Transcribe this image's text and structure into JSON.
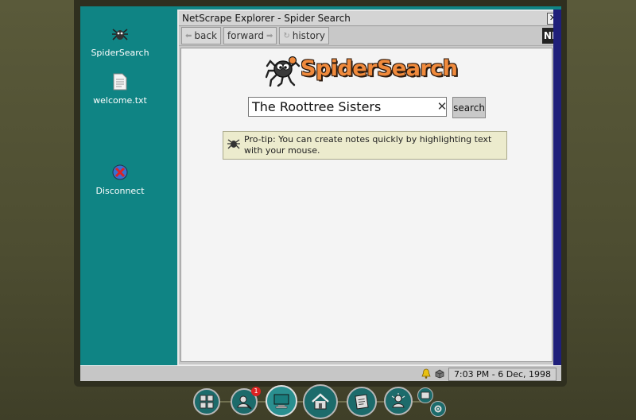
{
  "desktop": {
    "icons": [
      {
        "label": "SpiderSearch",
        "icon": "spider-icon"
      },
      {
        "label": "welcome.txt",
        "icon": "text-file-icon"
      },
      {
        "label": "Disconnect",
        "icon": "disconnect-icon"
      }
    ]
  },
  "window": {
    "title": "NetScrape Explorer - Spider Search",
    "close_label": "✕",
    "toolbar": {
      "back_label": "back",
      "forward_label": "forward",
      "history_label": "history",
      "ne_logo": "NE"
    }
  },
  "page": {
    "logo_text": "SpiderSearch",
    "search_value": "The Roottree Sisters",
    "clear_label": "✕",
    "search_button": "search",
    "protip": "Pro-tip: You can create notes quickly by highlighting text with your mouse."
  },
  "taskbar": {
    "clock": "7:03 PM - 6 Dec, 1998"
  },
  "dock": {
    "items": [
      {
        "name": "tools",
        "icon": "grid-tools-icon"
      },
      {
        "name": "profile-search",
        "icon": "profile-search-icon",
        "badge": "1"
      },
      {
        "name": "computer",
        "icon": "computer-icon"
      },
      {
        "name": "home",
        "icon": "home-icon"
      },
      {
        "name": "notes",
        "icon": "notes-icon"
      },
      {
        "name": "contacts",
        "icon": "person-icon"
      },
      {
        "name": "settings",
        "icon": "gear-icon"
      }
    ]
  },
  "colors": {
    "desktop": "#0f8484",
    "logo_orange": "#f08a3c",
    "protip_bg": "#ecebcd"
  }
}
